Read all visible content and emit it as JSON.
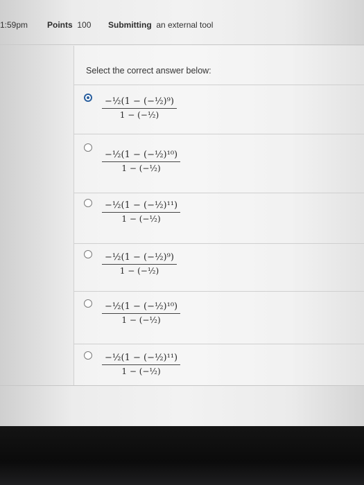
{
  "header": {
    "time": "1:59pm",
    "points_label": "Points",
    "points_value": "100",
    "submitting_label": "Submitting",
    "submitting_text": "an external tool"
  },
  "question": {
    "prompt": "Select the correct answer below:",
    "selected_index": 0,
    "options": [
      {
        "numerator": "−½(1 − (−½)⁹)",
        "denominator": "1 − (−½)"
      },
      {
        "numerator": "−½(1 − (−½)¹⁰)",
        "denominator": "1 − (−½)"
      },
      {
        "numerator": "−½(1 − (−½)¹¹)",
        "denominator": "1 − (−½)"
      },
      {
        "numerator": "−½(1 − (−½)⁹)",
        "denominator": "1 − (−½)"
      },
      {
        "numerator": "−½(1 − (−½)¹⁰)",
        "denominator": "1 − (−½)"
      },
      {
        "numerator": "−½(1 − (−½)¹¹)",
        "denominator": "1 − (−½)"
      }
    ]
  },
  "colors": {
    "accent": "#2a5f9e",
    "text": "#333333"
  }
}
